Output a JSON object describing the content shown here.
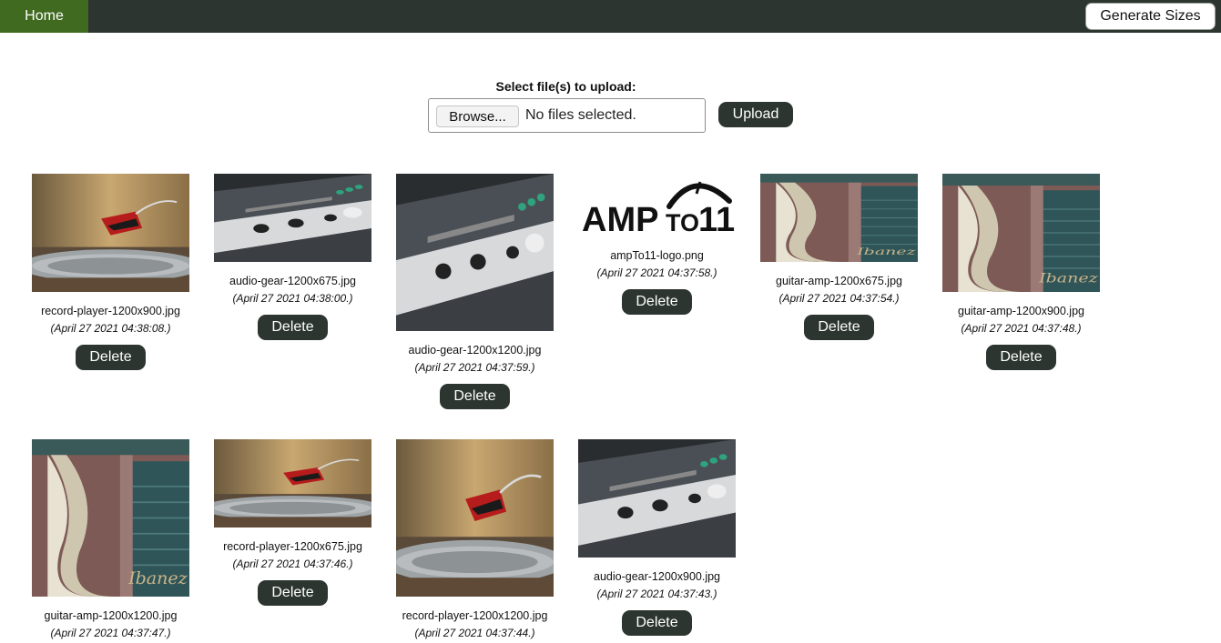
{
  "nav": {
    "home_label": "Home",
    "generate_label": "Generate Sizes"
  },
  "upload": {
    "label": "Select file(s) to upload:",
    "browse_label": "Browse...",
    "file_status": "No files selected.",
    "upload_label": "Upload"
  },
  "gallery": {
    "delete_label": "Delete",
    "items": [
      {
        "filename": "record-player-1200x900.jpg",
        "date": "(April 27 2021 04:38:08.)",
        "image": "record-player"
      },
      {
        "filename": "audio-gear-1200x675.jpg",
        "date": "(April 27 2021 04:38:00.)",
        "image": "audio-gear"
      },
      {
        "filename": "audio-gear-1200x1200.jpg",
        "date": "(April 27 2021 04:37:59.)",
        "image": "audio-gear"
      },
      {
        "filename": "ampTo11-logo.png",
        "date": "(April 27 2021 04:37:58.)",
        "image": "amp-logo",
        "logo_text_big": "AMP",
        "logo_text_small": "TO",
        "logo_text_num": "11"
      },
      {
        "filename": "guitar-amp-1200x675.jpg",
        "date": "(April 27 2021 04:37:54.)",
        "image": "guitar-amp"
      },
      {
        "filename": "guitar-amp-1200x900.jpg",
        "date": "(April 27 2021 04:37:48.)",
        "image": "guitar-amp"
      },
      {
        "filename": "guitar-amp-1200x1200.jpg",
        "date": "(April 27 2021 04:37:47.)",
        "image": "guitar-amp"
      },
      {
        "filename": "record-player-1200x675.jpg",
        "date": "(April 27 2021 04:37:46.)",
        "image": "record-player"
      },
      {
        "filename": "record-player-1200x1200.jpg",
        "date": "(April 27 2021 04:37:44.)",
        "image": "record-player"
      },
      {
        "filename": "audio-gear-1200x900.jpg",
        "date": "(April 27 2021 04:37:43.)",
        "image": "audio-gear"
      }
    ]
  },
  "colors": {
    "topbar": "#2c3530",
    "home_active": "#3f6a1f",
    "button": "#2c3530"
  }
}
